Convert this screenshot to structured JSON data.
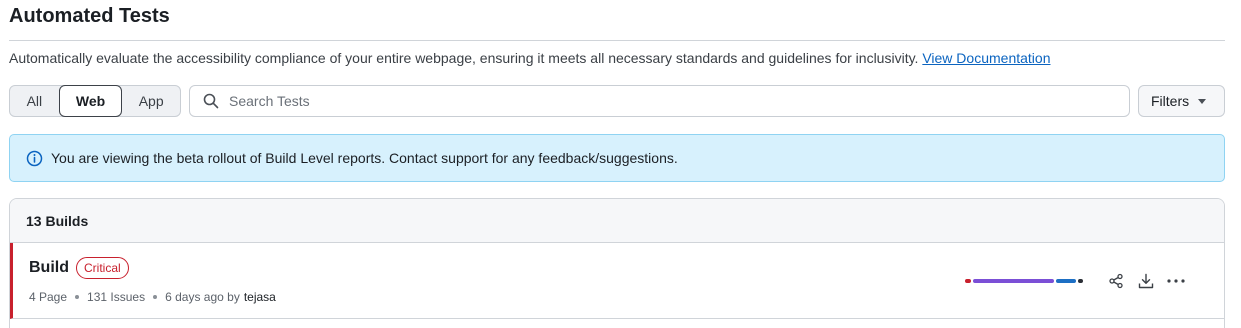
{
  "page": {
    "title": "Automated Tests",
    "description": "Automatically evaluate the accessibility compliance of your entire webpage, ensuring it meets all necessary standards and guidelines for inclusivity.",
    "doc_link": "View Documentation"
  },
  "tabs": [
    {
      "label": "All",
      "selected": false
    },
    {
      "label": "Web",
      "selected": true
    },
    {
      "label": "App",
      "selected": false
    }
  ],
  "search": {
    "placeholder": "Search Tests",
    "value": ""
  },
  "filters": {
    "label": "Filters",
    "icon": "caret-down-icon"
  },
  "banner": {
    "icon": "info-icon",
    "text": "You are viewing the beta rollout of Build Level reports. Contact support for any feedback/suggestions."
  },
  "builds": {
    "count_label": "13 Builds",
    "rows": [
      {
        "name": "Build",
        "badge": "Critical",
        "pages": "4 Page",
        "issues": "131 Issues",
        "time": "6 days ago by",
        "author": "tejasa",
        "severity_colors": {
          "critical": "#c8202d",
          "serious": "#7b4fd6",
          "moderate": "#1d6fc4",
          "minor": "#2b2f36"
        },
        "severity_distribution": {
          "critical": 0.05,
          "serious": 0.7,
          "moderate": 0.17,
          "minor": 0.04
        }
      }
    ]
  },
  "colors": {
    "link": "#0b64c0",
    "banner_bg": "#d7f1fd",
    "critical": "#c8202d"
  }
}
